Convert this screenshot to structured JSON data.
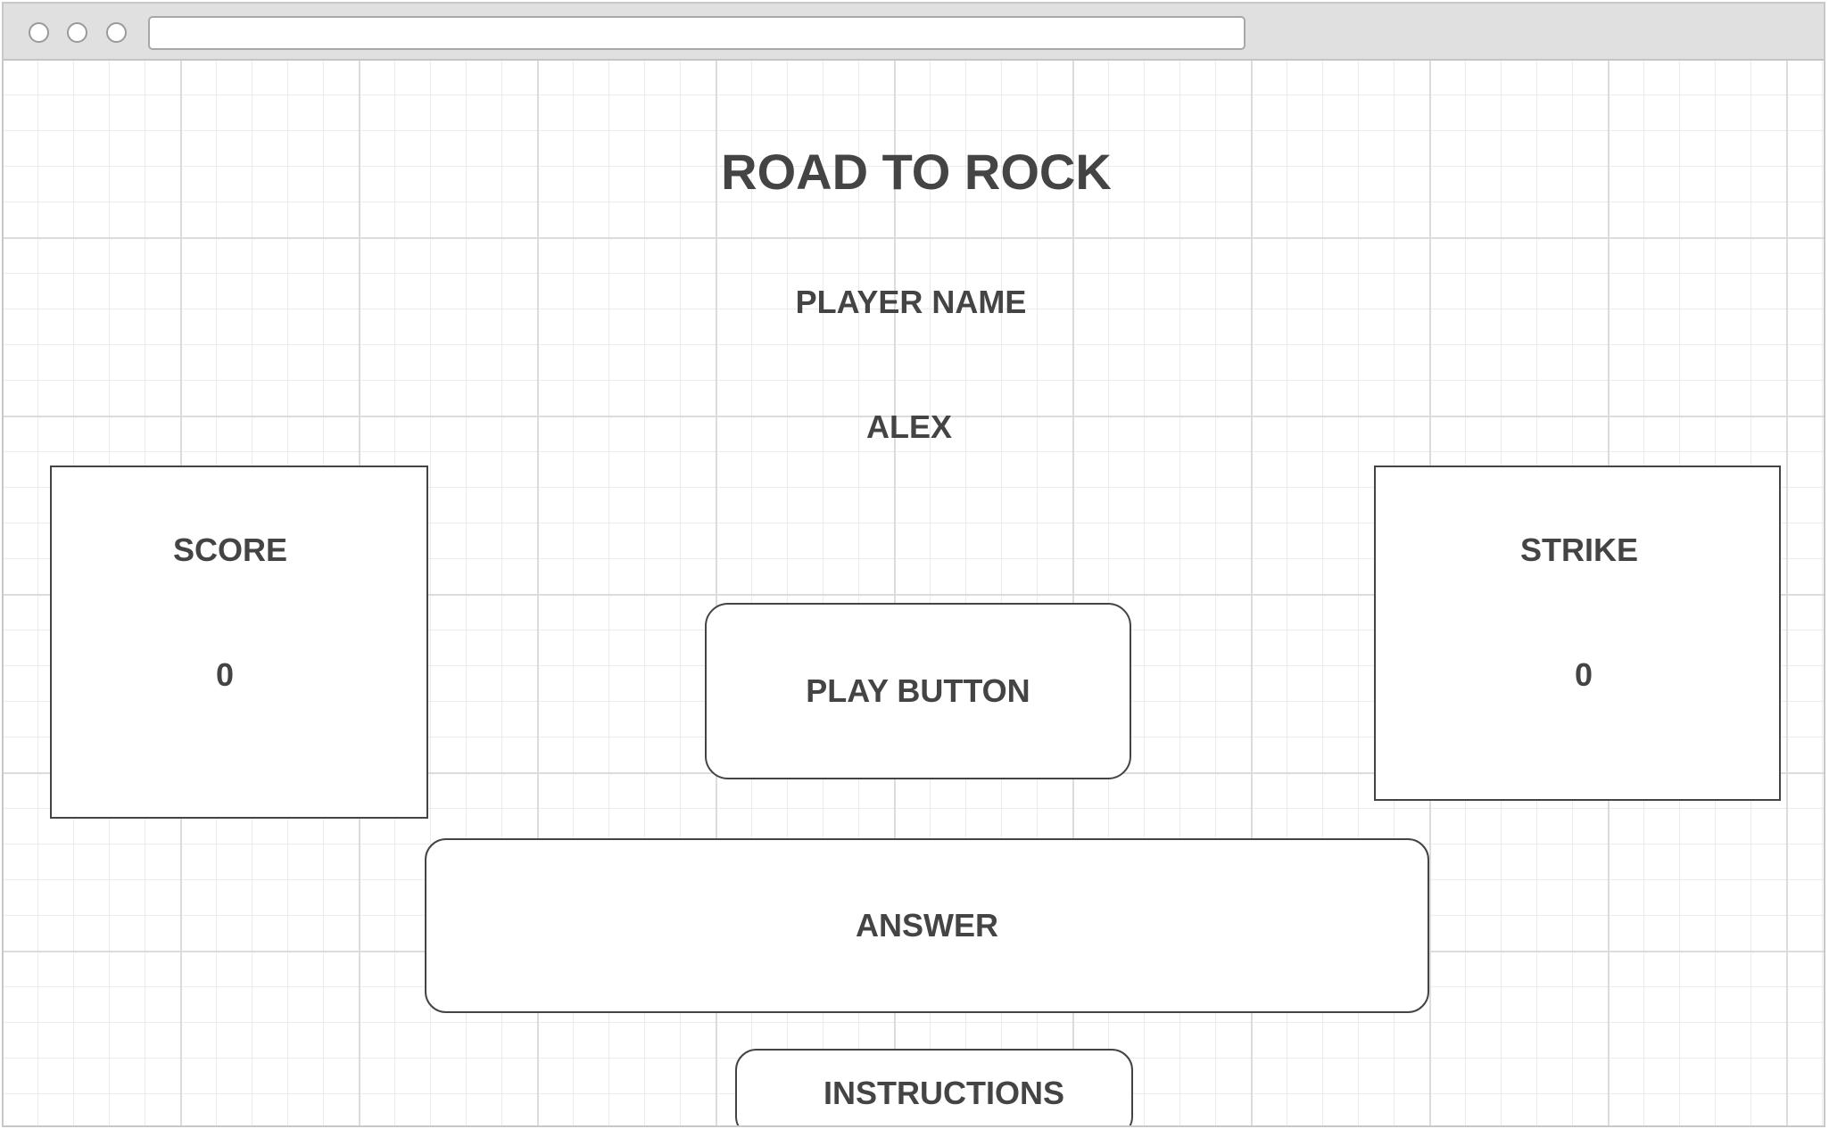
{
  "app": {
    "title": "ROAD TO ROCK"
  },
  "browser": {
    "url": ""
  },
  "player": {
    "name_label": "PLAYER NAME",
    "name": "ALEX"
  },
  "score": {
    "label": "SCORE",
    "value": "0"
  },
  "strike": {
    "label": "STRIKE",
    "value": "0"
  },
  "controls": {
    "play_label": "PLAY BUTTON",
    "answer_label": "ANSWER",
    "instructions_label": "INSTRUCTIONS"
  },
  "colors": {
    "text": "#444444",
    "border": "#444444",
    "chrome": "#e0e0e0",
    "grid": "#dcdcdc"
  }
}
